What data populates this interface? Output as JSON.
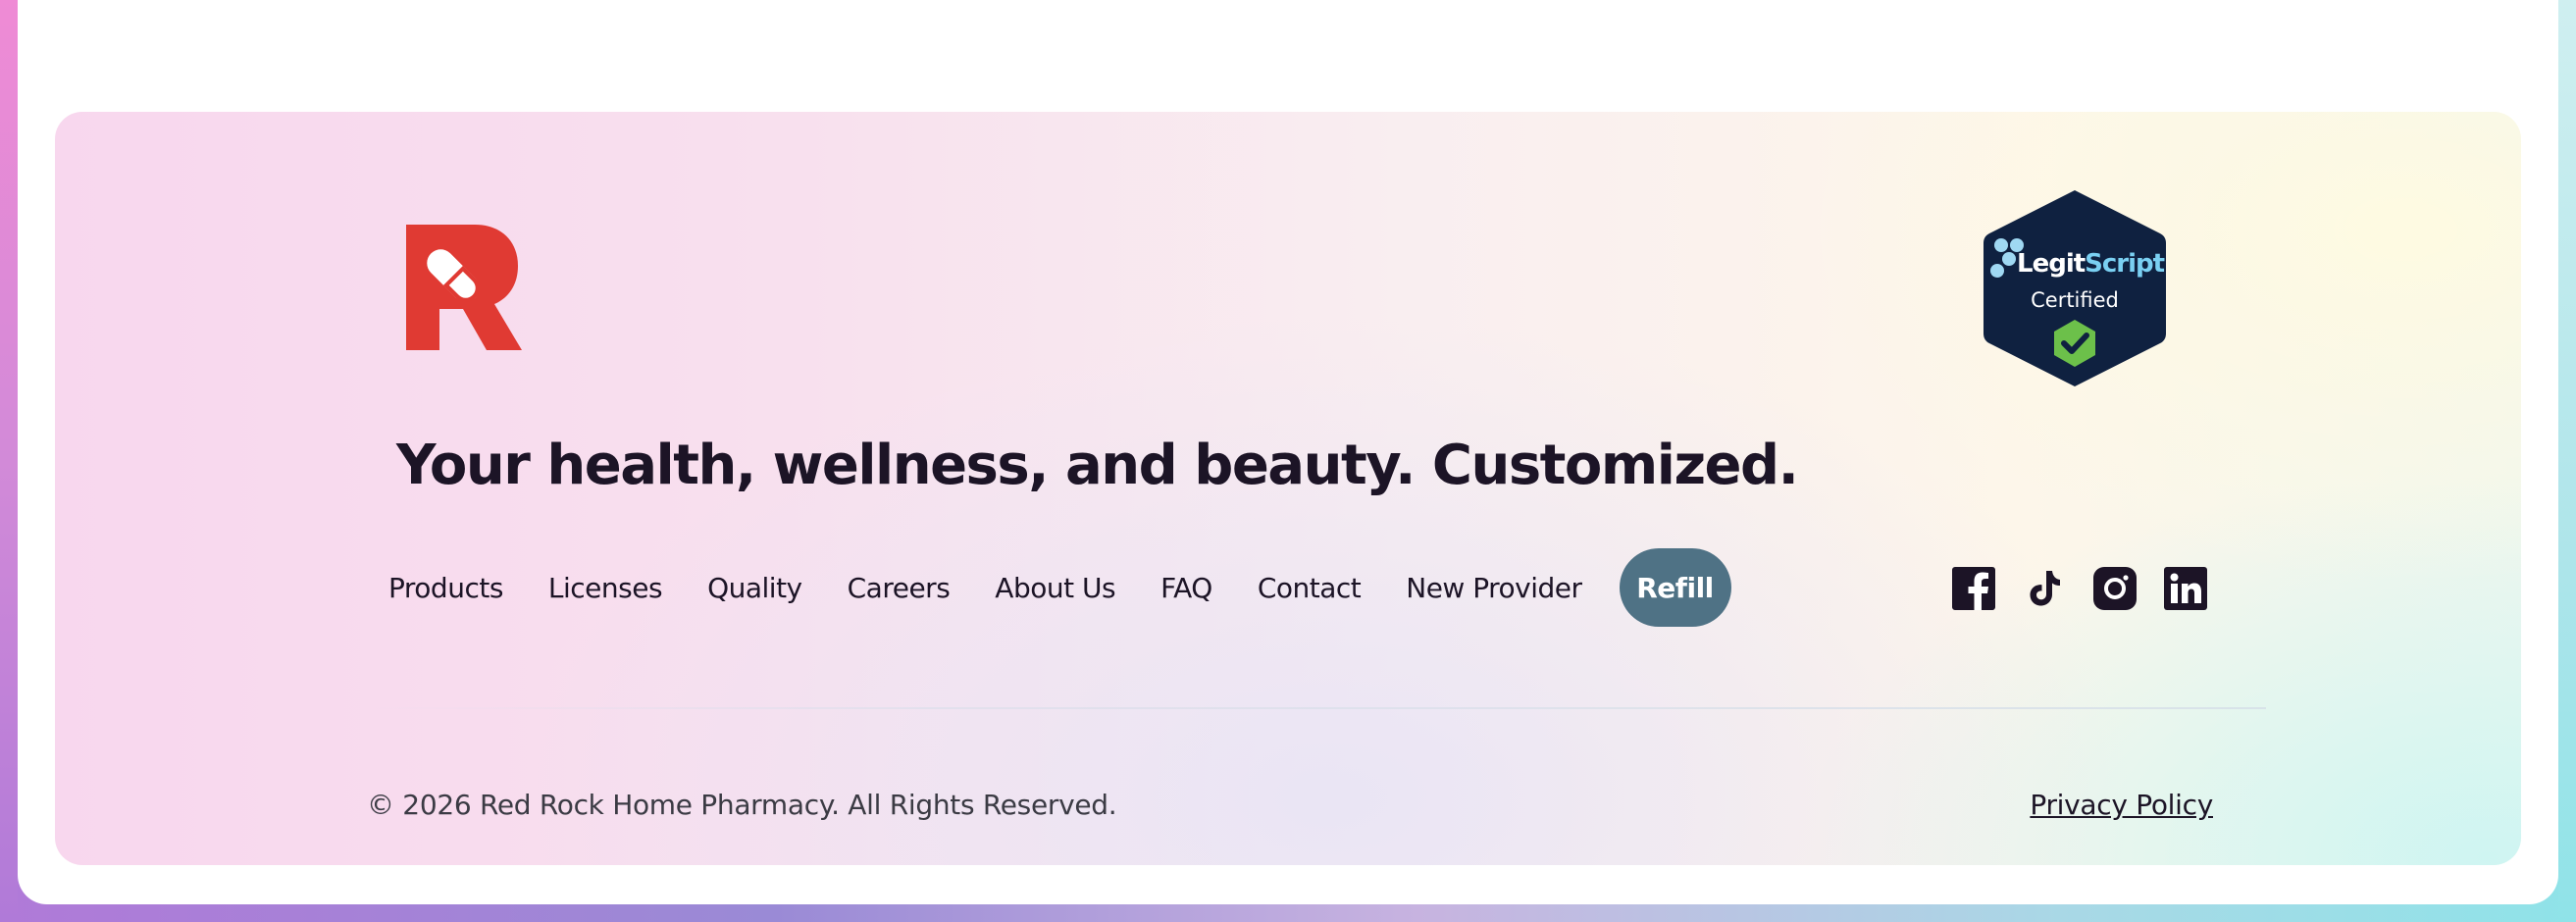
{
  "brand": {
    "logo_icon": "red-rock-r-pill-logo",
    "logo_color": "#e03a33",
    "tagline": "Your health, wellness, and beauty. Customized."
  },
  "certification": {
    "icon": "legitscript-certified-badge",
    "name_part1": "Legit",
    "name_part2": "Script",
    "status": "Certified",
    "badge_color": "#0f2140",
    "check_color": "#6cc04a"
  },
  "nav": {
    "links": [
      "Products",
      "Licenses",
      "Quality",
      "Careers",
      "About Us",
      "FAQ",
      "Contact",
      "New Provider"
    ],
    "cta_label": "Refill",
    "cta_color": "#4f7285"
  },
  "social": {
    "icons": [
      "facebook-icon",
      "tiktok-icon",
      "instagram-icon",
      "linkedin-icon"
    ]
  },
  "legal": {
    "copyright": "© 2026 Red Rock Home Pharmacy. All Rights Reserved.",
    "privacy_label": "Privacy Policy"
  }
}
